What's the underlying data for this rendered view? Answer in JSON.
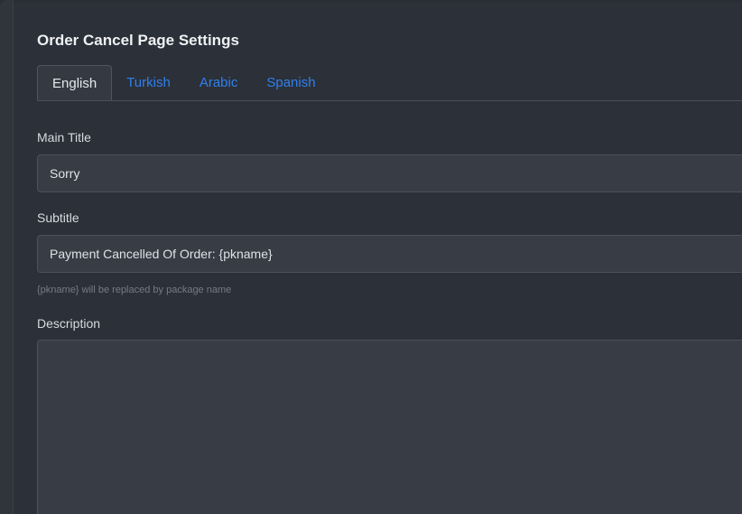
{
  "page": {
    "title": "Order Cancel Page Settings"
  },
  "tabs": [
    {
      "label": "English",
      "active": true
    },
    {
      "label": "Turkish",
      "active": false
    },
    {
      "label": "Arabic",
      "active": false
    },
    {
      "label": "Spanish",
      "active": false
    }
  ],
  "form": {
    "main_title": {
      "label": "Main Title",
      "value": "Sorry"
    },
    "subtitle": {
      "label": "Subtitle",
      "value": "Payment Cancelled Of Order: {pkname}",
      "hint": "{pkname} will be replaced by package name"
    },
    "description": {
      "label": "Description",
      "value": ""
    }
  },
  "colors": {
    "accent": "#2f80ed",
    "background": "#2c3038",
    "input_background": "#383c45"
  }
}
